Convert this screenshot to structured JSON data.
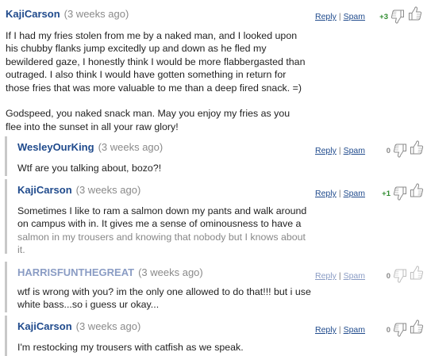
{
  "comments": [
    {
      "author": "KajiCarson",
      "age": "(3 weeks ago)",
      "reply_label": "Reply",
      "separator": "|",
      "spam_label": "Spam",
      "score": "+3",
      "body": "If I had my fries stolen from me by a naked man, and I looked upon\nhis chubby flanks jump excitedly up and down as he fled my\nbewildered gaze, I honestly think I would be more flabbergasted than\noutraged. I also think I would have gotten something in return for\nthose fries that was more valuable to me than a deep fired snack. =)\n\nGodspeed, you naked snack man. May you enjoy my fries as you\nflee into the sunset in all your raw glory!"
    },
    {
      "author": "WesleyOurKing",
      "age": "(3 weeks ago)",
      "reply_label": "Reply",
      "separator": "|",
      "spam_label": "Spam",
      "score": "0",
      "body": "Wtf are you talking about, bozo?!"
    },
    {
      "author": "KajiCarson",
      "age": "(3 weeks ago)",
      "reply_label": "Reply",
      "separator": "|",
      "spam_label": "Spam",
      "score": "+1",
      "body": "Sometimes I like to ram a salmon down my pants and walk around\non campus with in. It gives me a sense of ominousness to have a",
      "body_faded": "salmon in my trousers and knowing that nobody but I knows about\nit."
    },
    {
      "author": "HARRISFUNTHEGREAT",
      "age": "(3 weeks ago)",
      "reply_label": "Reply",
      "separator": "|",
      "spam_label": "Spam",
      "score": "0",
      "body": "wtf is wrong with you? im the only one allowed to do that!!! but i use\nwhite bass...so i guess ur okay..."
    },
    {
      "author": "KajiCarson",
      "age": "(3 weeks ago)",
      "reply_label": "Reply",
      "separator": "|",
      "spam_label": "Spam",
      "score": "0",
      "body": "I'm restocking my trousers with catfish as we speak."
    }
  ],
  "colors": {
    "author": "#1f4a8c",
    "author_muted": "#8a9cc4",
    "score_positive": "#2e8b2e",
    "reply_bar": "#c8c8c8"
  },
  "icons": {
    "thumb_down": "thumbs-down-icon",
    "thumb_up": "thumbs-up-icon"
  }
}
